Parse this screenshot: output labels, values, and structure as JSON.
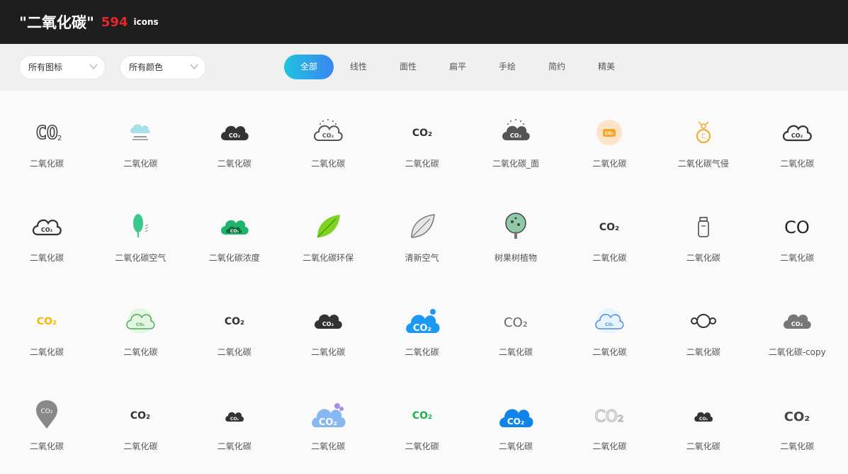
{
  "header": {
    "title": "\"二氧化碳\"",
    "count": "594",
    "unit": "icons"
  },
  "filters": {
    "type_select": "所有图标",
    "color_select": "所有颜色",
    "tabs": [
      "全部",
      "线性",
      "面性",
      "扁平",
      "手绘",
      "简约",
      "精美"
    ],
    "active_tab": "全部"
  },
  "icons": [
    {
      "label": "二氧化碳",
      "icon": "co2-outline-text-icon"
    },
    {
      "label": "二氧化碳",
      "icon": "air-pollution-cloud-icon"
    },
    {
      "label": "二氧化碳",
      "icon": "co2-dark-cloud-icon"
    },
    {
      "label": "二氧化碳",
      "icon": "co2-cloud-sparkle-icon"
    },
    {
      "label": "二氧化碳",
      "icon": "co2-text-icon"
    },
    {
      "label": "二氧化碳_面",
      "icon": "co2-cloud-filled-sparkle-icon"
    },
    {
      "label": "二氧化碳",
      "icon": "co2-orange-badge-icon"
    },
    {
      "label": "二氧化碳气侵",
      "icon": "co2-bubble-orange-icon"
    },
    {
      "label": "二氧化碳",
      "icon": "co2-cloud-outline-icon"
    },
    {
      "label": "二氧化碳",
      "icon": "co2-cloud-outline-icon"
    },
    {
      "label": "二氧化碳空气",
      "icon": "tree-air-icon"
    },
    {
      "label": "二氧化碳浓度",
      "icon": "co2-green-cloud-icon"
    },
    {
      "label": "二氧化碳环保",
      "icon": "leaf-icon"
    },
    {
      "label": "清新空气",
      "icon": "leaf-outline-icon"
    },
    {
      "label": "树果树植物",
      "icon": "fruit-tree-icon"
    },
    {
      "label": "二氧化碳",
      "icon": "co2-text-icon"
    },
    {
      "label": "二氧化碳",
      "icon": "bottle-icon"
    },
    {
      "label": "二氧化碳",
      "icon": "co-text-icon"
    },
    {
      "label": "二氧化碳",
      "icon": "co2-yellow-text-icon"
    },
    {
      "label": "二氧化碳",
      "icon": "co2-green-circle-icon"
    },
    {
      "label": "二氧化碳",
      "icon": "co2-text-icon"
    },
    {
      "label": "二氧化碳",
      "icon": "co2-dark-cloud-icon"
    },
    {
      "label": "二氧化碳",
      "icon": "co2-blue-cloud-icon"
    },
    {
      "label": "二氧化碳",
      "icon": "co2-thin-text-icon"
    },
    {
      "label": "二氧化碳",
      "icon": "co2-light-blue-cloud-icon"
    },
    {
      "label": "二氧化碳",
      "icon": "molecule-icon"
    },
    {
      "label": "二氧化碳-copy",
      "icon": "co2-gray-cloud-icon"
    },
    {
      "label": "二氧化碳",
      "icon": "co2-pin-icon"
    },
    {
      "label": "二氧化碳",
      "icon": "co2-text-icon"
    },
    {
      "label": "二氧化碳",
      "icon": "co2-small-dark-cloud-icon"
    },
    {
      "label": "二氧化碳",
      "icon": "co2-light-blue-big-cloud-icon"
    },
    {
      "label": "二氧化碳",
      "icon": "co2-green-text-icon"
    },
    {
      "label": "二氧化碳",
      "icon": "co2-blue-filled-cloud-icon"
    },
    {
      "label": "二氧化碳",
      "icon": "co2-outline-light-text-icon"
    },
    {
      "label": "二氧化碳",
      "icon": "co2-small-dark-cloud-icon"
    },
    {
      "label": "二氧化碳",
      "icon": "co2-bold-text-icon"
    }
  ],
  "colors": {
    "accent_red": "#e5262b",
    "tab_gradient_start": "#1fc4e0",
    "tab_gradient_end": "#3a86f0"
  }
}
